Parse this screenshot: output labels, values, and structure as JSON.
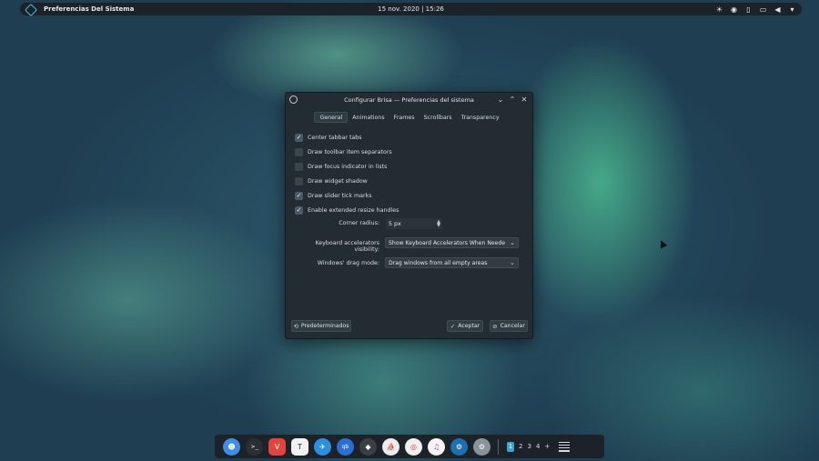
{
  "top_panel": {
    "app_name": "Preferencias Del Sistema",
    "clock": "15 nov. 2020 | 15:26",
    "tray_icons": [
      "brightness-icon",
      "media-icon",
      "clipboard-icon",
      "display-icon",
      "volume-icon",
      "chevron-down-icon"
    ]
  },
  "dialog": {
    "title": "Configurar Brisa — Preferencias del sistema",
    "tabs": [
      {
        "label": "General",
        "active": true
      },
      {
        "label": "Animations",
        "active": false
      },
      {
        "label": "Frames",
        "active": false
      },
      {
        "label": "Scrollbars",
        "active": false
      },
      {
        "label": "Transparency",
        "active": false
      }
    ],
    "options": [
      {
        "label": "Center tabbar tabs",
        "checked": true
      },
      {
        "label": "Draw toolbar item separators",
        "checked": false
      },
      {
        "label": "Draw focus indicator in lists",
        "checked": false
      },
      {
        "label": "Draw widget shadow",
        "checked": false
      },
      {
        "label": "Draw slider tick marks",
        "checked": true
      },
      {
        "label": "Enable extended resize handles",
        "checked": true
      }
    ],
    "corner_radius": {
      "label": "Corner radius:",
      "value": "5 px"
    },
    "keyboard_accel": {
      "label": "Keyboard accelerators visibility:",
      "value": "Show Keyboard Accelerators When Needed"
    },
    "drag_mode": {
      "label": "Windows' drag mode:",
      "value": "Drag windows from all empty areas"
    },
    "buttons": {
      "defaults": "Predeterminados",
      "accept": "Aceptar",
      "cancel": "Cancelar"
    }
  },
  "dock": {
    "apps": [
      {
        "name": "finder-icon",
        "color": "#3e8ee6"
      },
      {
        "name": "terminal-icon",
        "color": "#2b2f33"
      },
      {
        "name": "vivaldi-icon",
        "color": "#e2443e"
      },
      {
        "name": "typora-icon",
        "color": "#f1f1f1"
      },
      {
        "name": "kite-icon",
        "color": "#2b8fe0"
      },
      {
        "name": "qbittorrent-icon",
        "color": "#2a6fd6"
      },
      {
        "name": "inkscape-icon",
        "color": "#3a3f44"
      },
      {
        "name": "ark-icon",
        "color": "#ececec"
      },
      {
        "name": "chrome-icon",
        "color": "#f0f0f0"
      },
      {
        "name": "itunes-icon",
        "color": "#f4f4f4"
      },
      {
        "name": "steam-icon",
        "color": "#1f6fb0"
      },
      {
        "name": "settings-icon",
        "color": "#8b9398"
      }
    ],
    "workspaces": [
      "1",
      "2",
      "3",
      "4"
    ],
    "add_label": "+"
  }
}
